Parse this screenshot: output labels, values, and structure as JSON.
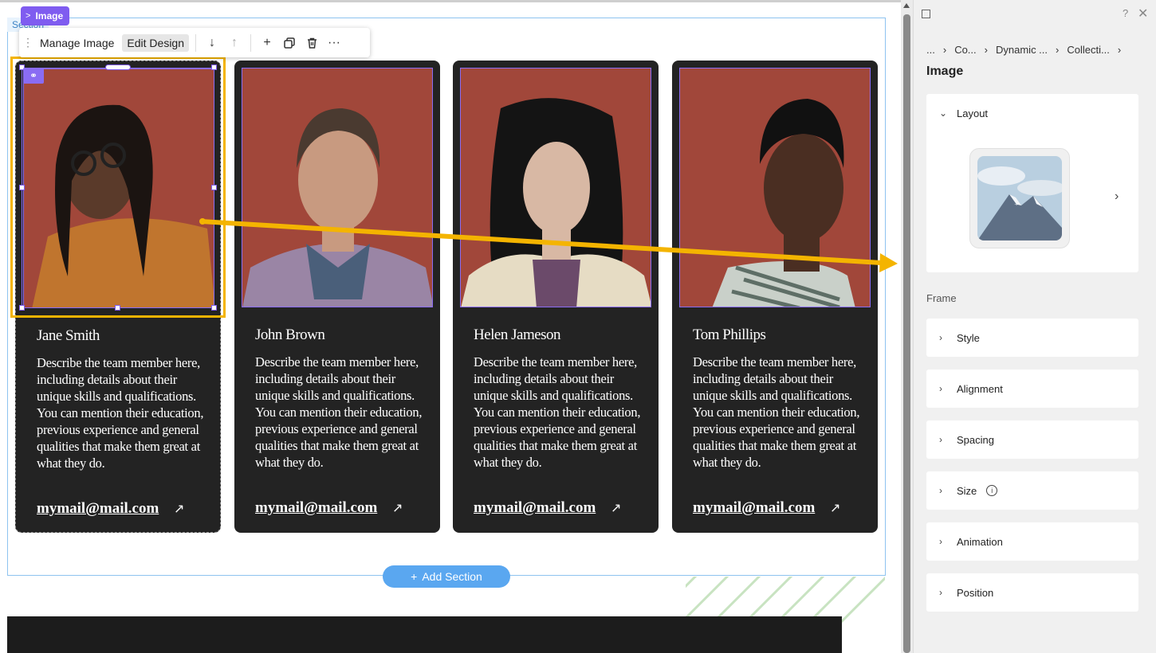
{
  "canvas": {
    "section_tag": "Section",
    "image_chip": "Image",
    "add_section": "Add Section"
  },
  "toolbar": {
    "manage_image": "Manage Image",
    "edit_design": "Edit Design",
    "move_down_icon": "arrow-down-icon",
    "move_up_icon": "arrow-up-icon",
    "add_icon": "plus-icon",
    "duplicate_icon": "duplicate-icon",
    "delete_icon": "trash-icon",
    "more_icon": "more-icon"
  },
  "cards": [
    {
      "name": "Jane Smith",
      "description": "Describe the team member here, including details about their unique skills and qualifications. You can mention their education, previous experience and general qualities that make them great at what they do.",
      "email": "mymail@mail.com",
      "skin": "#5a3a2a",
      "shirt": "#c0752e"
    },
    {
      "name": "John Brown",
      "description": "Describe the team member here, including details about their unique skills and qualifications. You can mention their education, previous experience and general qualities that make them great at what they do.",
      "email": "mymail@mail.com",
      "skin": "#c89a80",
      "shirt": "#9a85a5"
    },
    {
      "name": "Helen Jameson",
      "description": "Describe the team member here, including details about their unique skills and qualifications. You can mention their education, previous experience and general qualities that make them great at what they do.",
      "email": "mymail@mail.com",
      "skin": "#d8b8a4",
      "shirt": "#e6dcc4"
    },
    {
      "name": "Tom Phillips",
      "description": "Describe the team member here, including details about their unique skills and qualifications. You can mention their education, previous experience and general qualities that make them great at what they do.",
      "email": "mymail@mail.com",
      "skin": "#4a2e22",
      "shirt": "#c9d0c9"
    }
  ],
  "panel": {
    "breadcrumb": [
      "...",
      "Co...",
      "Dynamic ...",
      "Collecti..."
    ],
    "title": "Image",
    "layout": "Layout",
    "frame": "Frame",
    "sections": [
      "Style",
      "Alignment",
      "Spacing",
      "Size",
      "Animation",
      "Position"
    ],
    "help": "?",
    "close": "✕"
  },
  "colors": {
    "accent_purple": "#7f5cf0",
    "selection_yellow": "#f4b400",
    "card_bg": "#232323",
    "photo_bg": "#a1473a",
    "add_section_blue": "#5aa7f0"
  }
}
